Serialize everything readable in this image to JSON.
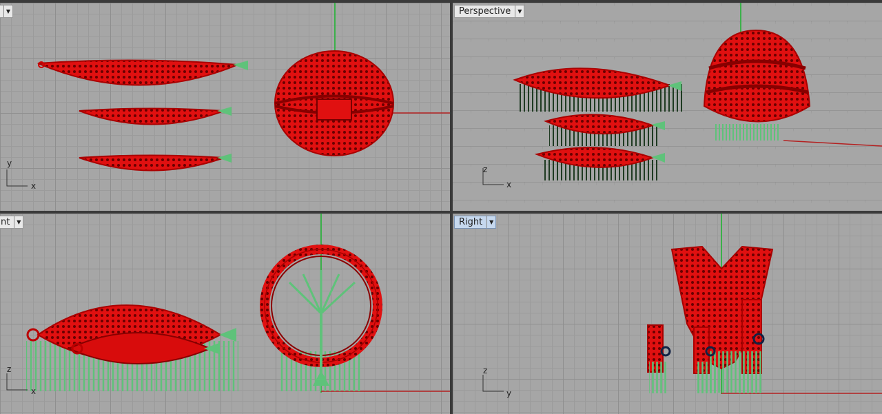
{
  "viewports": {
    "top": {
      "label": "",
      "axis_labels": {
        "vertical": "y",
        "horizontal": "x"
      }
    },
    "perspective": {
      "label": "Perspective",
      "axis_labels": {
        "vertical": "z",
        "horizontal": "x"
      }
    },
    "front": {
      "label": "nt",
      "axis_labels": {
        "vertical": "z",
        "horizontal": "x"
      }
    },
    "right": {
      "label": "Right",
      "axis_labels": {
        "vertical": "z",
        "horizontal": "y"
      }
    }
  },
  "icons": {
    "dropdown": "chevron-down-icon"
  },
  "colors": {
    "model": "#e01010",
    "model_dark": "#8a0000",
    "supports": "#5fc27a",
    "grid_bg": "#a6a6a6",
    "active_label": "#c6d8ee"
  }
}
